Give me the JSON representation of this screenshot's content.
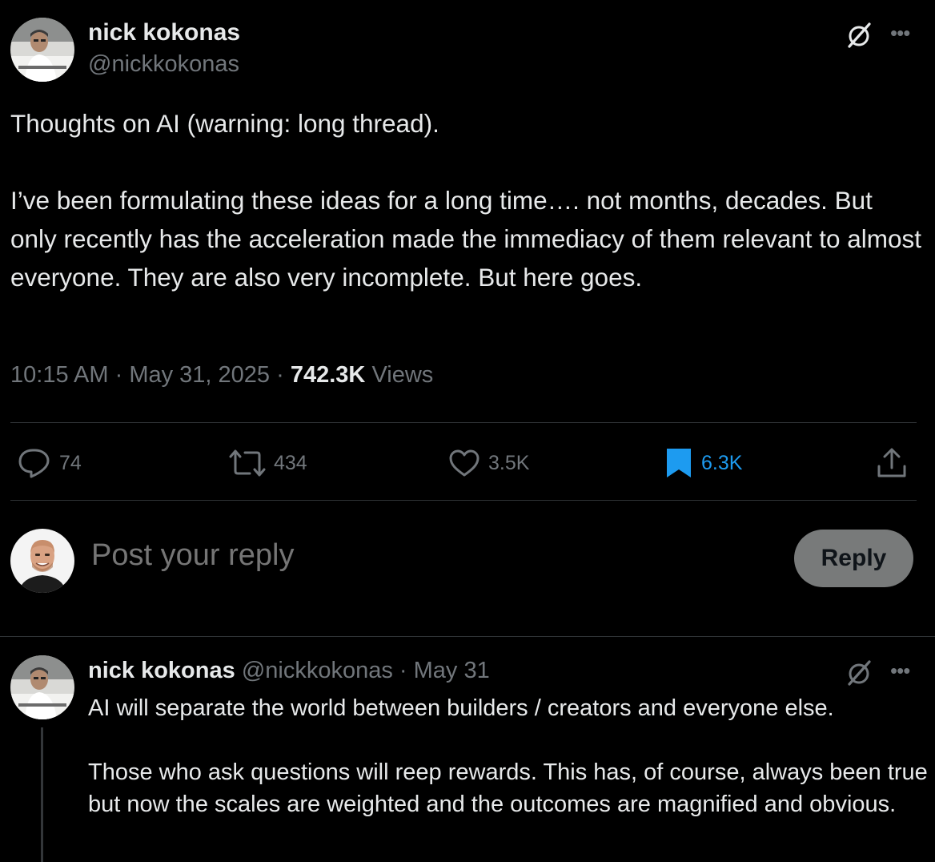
{
  "tweet": {
    "author_name": "nick kokonas",
    "author_handle": "@nickkokonas",
    "paragraphs": [
      "Thoughts on AI (warning: long thread).",
      "I’ve been formulating these ideas for a long time…. not months, decades. But only recently has the acceleration made the immediacy of them relevant to almost everyone. They are also very incomplete. But here goes."
    ],
    "time": "10:15 AM",
    "date": "May 31, 2025",
    "separator": "·",
    "views_count": "742.3K",
    "views_label": "Views"
  },
  "actions": {
    "replies": "74",
    "reposts": "434",
    "likes": "3.5K",
    "bookmarks": "6.3K"
  },
  "composer": {
    "placeholder": "Post your reply",
    "button_label": "Reply"
  },
  "thread_reply": {
    "author_name": "nick kokonas",
    "author_handle": "@nickkokonas",
    "separator": "·",
    "date": "May 31",
    "paragraphs": [
      "AI will separate the world between builders / creators and everyone else.",
      "Those who ask questions will reep rewards. This has, of course, always been true but now the scales are weighted and the outcomes are magnified and obvious."
    ]
  },
  "colors": {
    "background": "#000000",
    "text_primary": "#e7e9ea",
    "text_secondary": "#71767b",
    "accent_blue": "#1d9bf0",
    "divider": "#2f3336",
    "reply_button_bg": "#787a7a"
  },
  "icons": {
    "grok": "grok-icon",
    "more": "more-icon",
    "reply": "reply-icon",
    "repost": "repost-icon",
    "like": "heart-icon",
    "bookmark": "bookmark-icon",
    "share": "share-icon"
  }
}
